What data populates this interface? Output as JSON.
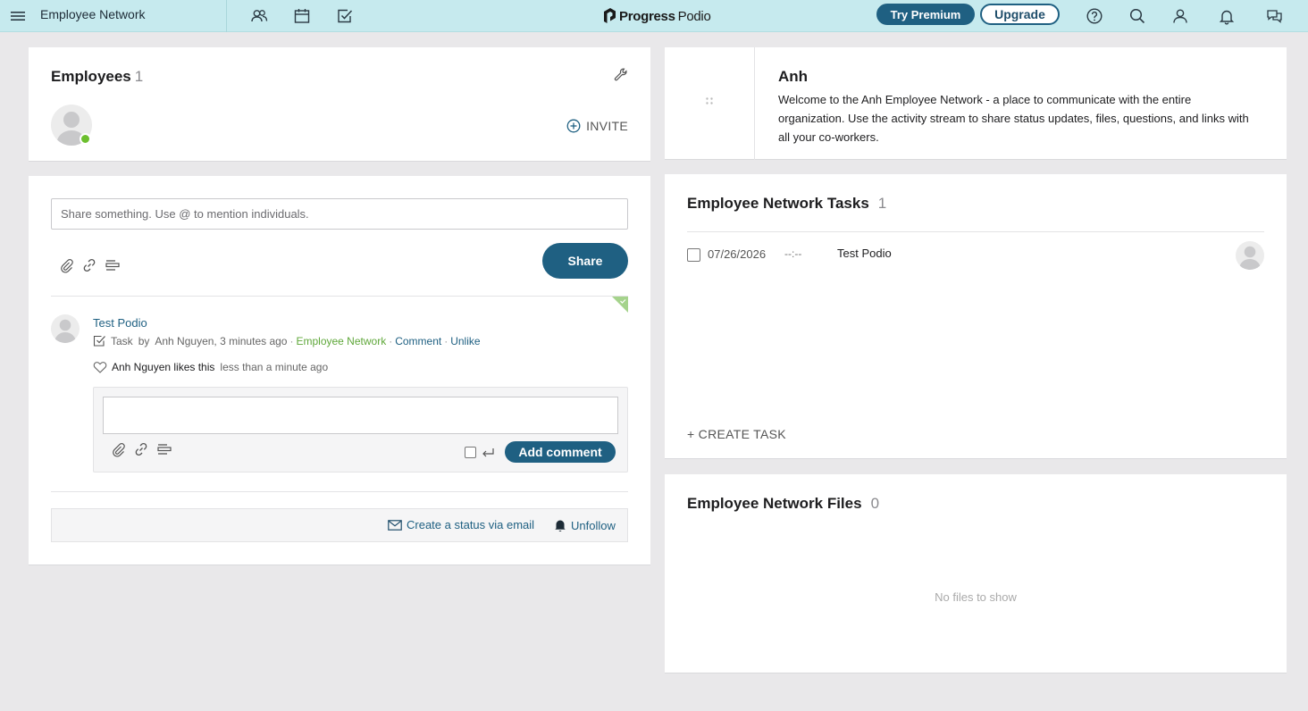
{
  "topbar": {
    "workspace_title": "Employee Network",
    "logo_word1": "Progress",
    "logo_word2": "Podio",
    "try_premium": "Try Premium",
    "upgrade": "Upgrade"
  },
  "employees": {
    "title": "Employees",
    "count": "1",
    "invite": "INVITE"
  },
  "stream": {
    "share_placeholder": "Share something. Use @ to mention individuals.",
    "share_button": "Share",
    "post": {
      "title": "Test Podio",
      "type": "Task",
      "by": "by",
      "author_time": "Anh Nguyen, 3 minutes ago",
      "workspace": "Employee Network",
      "comment": "Comment",
      "unlike": "Unlike",
      "likes_who": "Anh Nguyen likes this",
      "likes_when": "less than a minute ago"
    },
    "add_comment": "Add comment",
    "create_status_email": "Create a status via email",
    "unfollow": "Unfollow"
  },
  "about": {
    "title": "Anh",
    "description": "Welcome to the Anh Employee Network - a place to communicate with the entire organization. Use the activity stream to share status updates, files, questions, and links with all your co-workers."
  },
  "tasks": {
    "title": "Employee Network Tasks",
    "count": "1",
    "items": [
      {
        "date": "07/26/2026",
        "time": "--:--",
        "name": "Test Podio"
      }
    ],
    "create": "+ CREATE TASK"
  },
  "files": {
    "title": "Employee Network Files",
    "count": "0",
    "empty": "No files to show"
  },
  "colors": {
    "topbar_bg": "#c6eaee",
    "accent": "#1f6082",
    "online": "#6cbf2e",
    "workspace_link": "#5fa73a",
    "page_bg": "#e9e8ea"
  }
}
